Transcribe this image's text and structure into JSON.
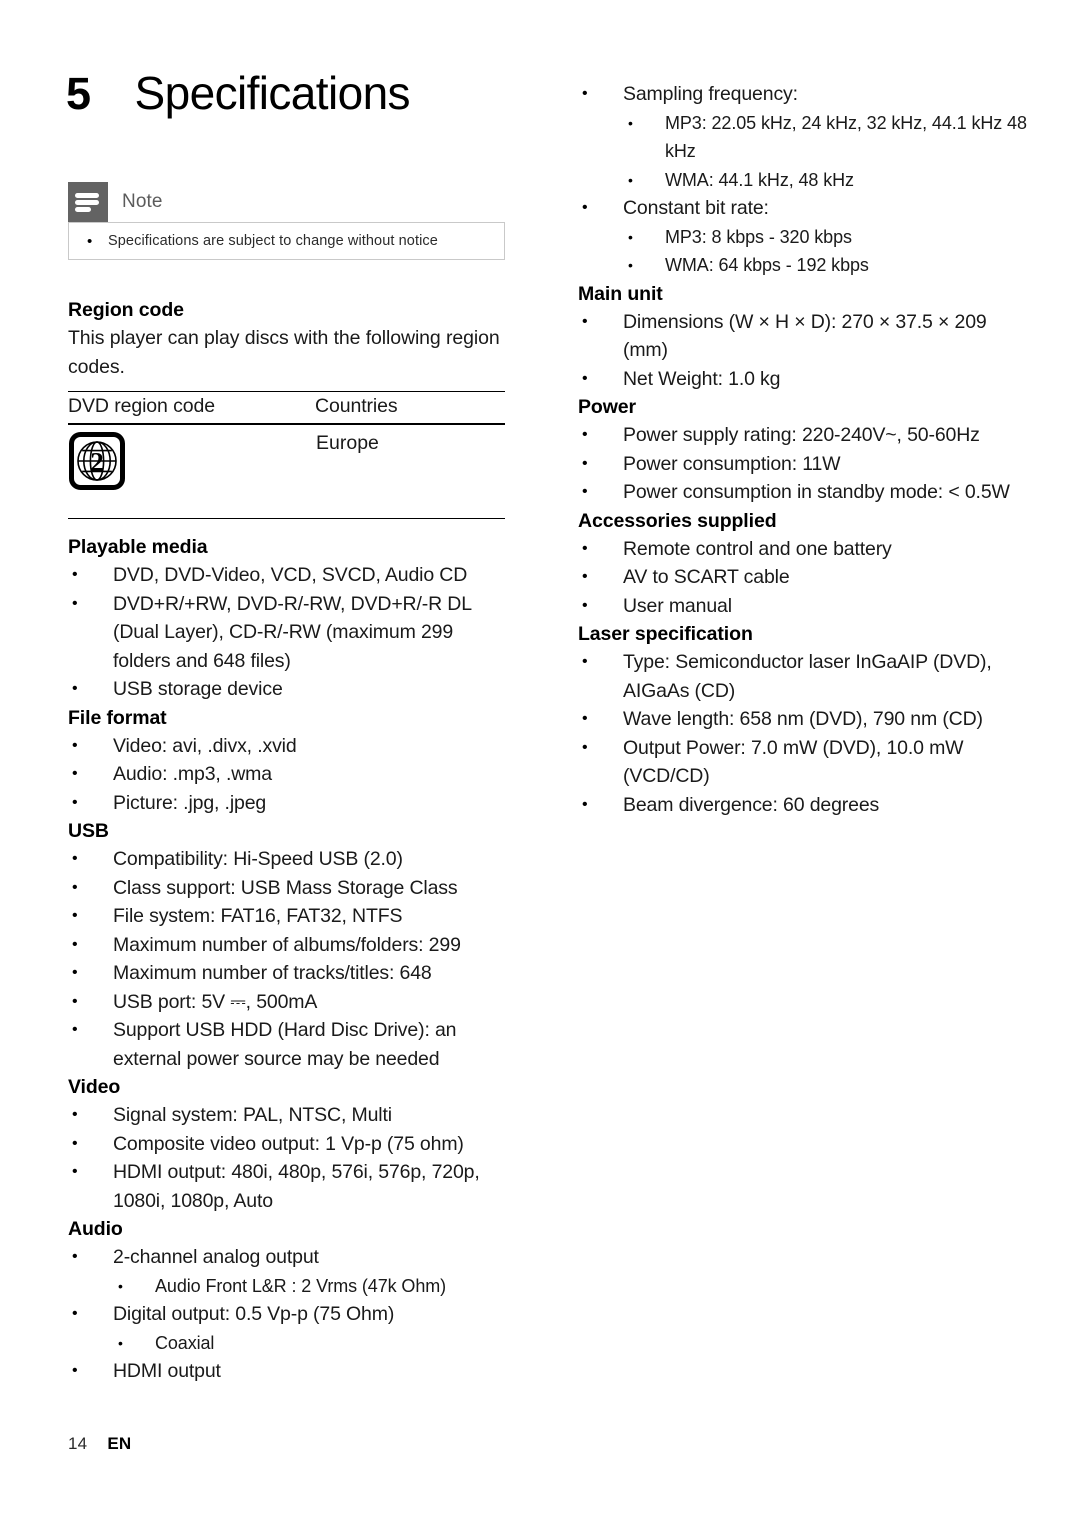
{
  "page": {
    "chapter_number": "5",
    "chapter_title": "Specifications",
    "footer_page": "14",
    "footer_lang": "EN"
  },
  "note": {
    "label": "Note",
    "icon": "note-lines-icon",
    "items": [
      "Specifications are subject to change without notice"
    ]
  },
  "region_code": {
    "heading": "Region code",
    "intro": "This player can play discs with the following region codes.",
    "table": {
      "columns": [
        "DVD region code",
        "Countries"
      ],
      "rows": [
        {
          "code_icon": "dvd-region-2-globe-icon",
          "code_value": "2",
          "country": "Europe"
        }
      ]
    }
  },
  "sections_left": [
    {
      "heading": "Playable media",
      "items": [
        {
          "text": "DVD, DVD-Video, VCD, SVCD, Audio CD"
        },
        {
          "text": "DVD+R/+RW, DVD-R/-RW, DVD+R/-R DL (Dual Layer), CD-R/-RW (maximum 299 folders and 648 files)"
        },
        {
          "text": "USB storage device"
        }
      ]
    },
    {
      "heading": "File format",
      "items": [
        {
          "text": "Video: avi, .divx, .xvid"
        },
        {
          "text": "Audio: .mp3, .wma"
        },
        {
          "text": "Picture: .jpg, .jpeg"
        }
      ]
    },
    {
      "heading": "USB",
      "items": [
        {
          "text": "Compatibility: Hi-Speed USB (2.0)"
        },
        {
          "text": "Class support: USB Mass Storage Class"
        },
        {
          "text": "File system: FAT16, FAT32, NTFS"
        },
        {
          "text": "Maximum number of albums/folders: 299"
        },
        {
          "text": "Maximum number of tracks/titles: 648"
        },
        {
          "text": "USB port: 5V ⎓, 500mA"
        },
        {
          "text": "Support USB HDD (Hard Disc Drive): an external power source may be needed"
        }
      ]
    },
    {
      "heading": "Video",
      "items": [
        {
          "text": "Signal system: PAL, NTSC, Multi"
        },
        {
          "text": "Composite video output: 1 Vp-p (75 ohm)"
        },
        {
          "text": "HDMI output: 480i, 480p, 576i, 576p, 720p, 1080i, 1080p, Auto"
        }
      ]
    },
    {
      "heading": "Audio",
      "items": [
        {
          "text": "2-channel analog output",
          "sub": [
            "Audio Front L&R : 2 Vrms (47k Ohm)"
          ]
        },
        {
          "text": "Digital output: 0.5 Vp-p (75 Ohm)",
          "sub": [
            "Coaxial"
          ]
        },
        {
          "text": "HDMI output"
        }
      ]
    }
  ],
  "sections_right": [
    {
      "heading": "",
      "items": [
        {
          "text": "Sampling frequency:",
          "sub": [
            "MP3: 22.05 kHz, 24 kHz, 32 kHz, 44.1 kHz 48 kHz",
            "WMA: 44.1 kHz, 48 kHz"
          ]
        },
        {
          "text": "Constant bit rate:",
          "sub": [
            "MP3: 8 kbps - 320 kbps",
            "WMA: 64 kbps - 192 kbps"
          ]
        }
      ]
    },
    {
      "heading": "Main unit",
      "items": [
        {
          "text": "Dimensions (W × H × D): 270 × 37.5 × 209 (mm)"
        },
        {
          "text": "Net Weight: 1.0 kg"
        }
      ]
    },
    {
      "heading": "Power",
      "items": [
        {
          "text": "Power supply rating: 220-240V~, 50-60Hz"
        },
        {
          "text": "Power consumption: 11W"
        },
        {
          "text": "Power consumption in standby mode: < 0.5W"
        }
      ]
    },
    {
      "heading": "Accessories supplied",
      "items": [
        {
          "text": "Remote control and one battery"
        },
        {
          "text": "AV to SCART cable"
        },
        {
          "text": "User manual"
        }
      ]
    },
    {
      "heading": "Laser specification",
      "items": [
        {
          "text": "Type: Semiconductor laser InGaAIP (DVD), AIGaAs (CD)"
        },
        {
          "text": "Wave length: 658 nm (DVD), 790 nm (CD)"
        },
        {
          "text": "Output Power: 7.0 mW (DVD), 10.0 mW (VCD/CD)"
        },
        {
          "text": "Beam divergence: 60 degrees"
        }
      ]
    }
  ]
}
